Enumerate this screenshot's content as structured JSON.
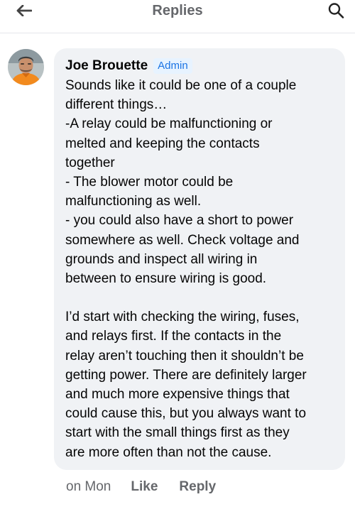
{
  "header": {
    "title": "Replies",
    "back_icon": "arrow-left-icon",
    "search_icon": "search-icon"
  },
  "comment": {
    "author": "Joe Brouette",
    "badge": "Admin",
    "paragraph1": "Sounds like it could be one of a couple\ndifferent things…\n-A relay could be malfunctioning or\nmelted and keeping the contacts\ntogether\n- The blower motor could be\nmalfunctioning as well.\n- you could also have a short to power\nsomewhere as well. Check voltage and\ngrounds and inspect all wiring in\nbetween to ensure wiring is good.",
    "paragraph2": "I’d start with checking the wiring, fuses,\nand relays first. If the contacts in the\nrelay aren’t touching then it shouldn’t be\ngetting power. There are definitely larger\nand much more expensive things that\ncould cause this, but you always want to\nstart with the small things first as they\nare more often than not the cause.",
    "time": "on Mon",
    "like_label": "Like",
    "reply_label": "Reply"
  },
  "colors": {
    "bubble": "#f0f2f5",
    "secondary_text": "#65676b",
    "badge_text": "#1b74e4",
    "badge_bg": "#e7f3ff"
  }
}
